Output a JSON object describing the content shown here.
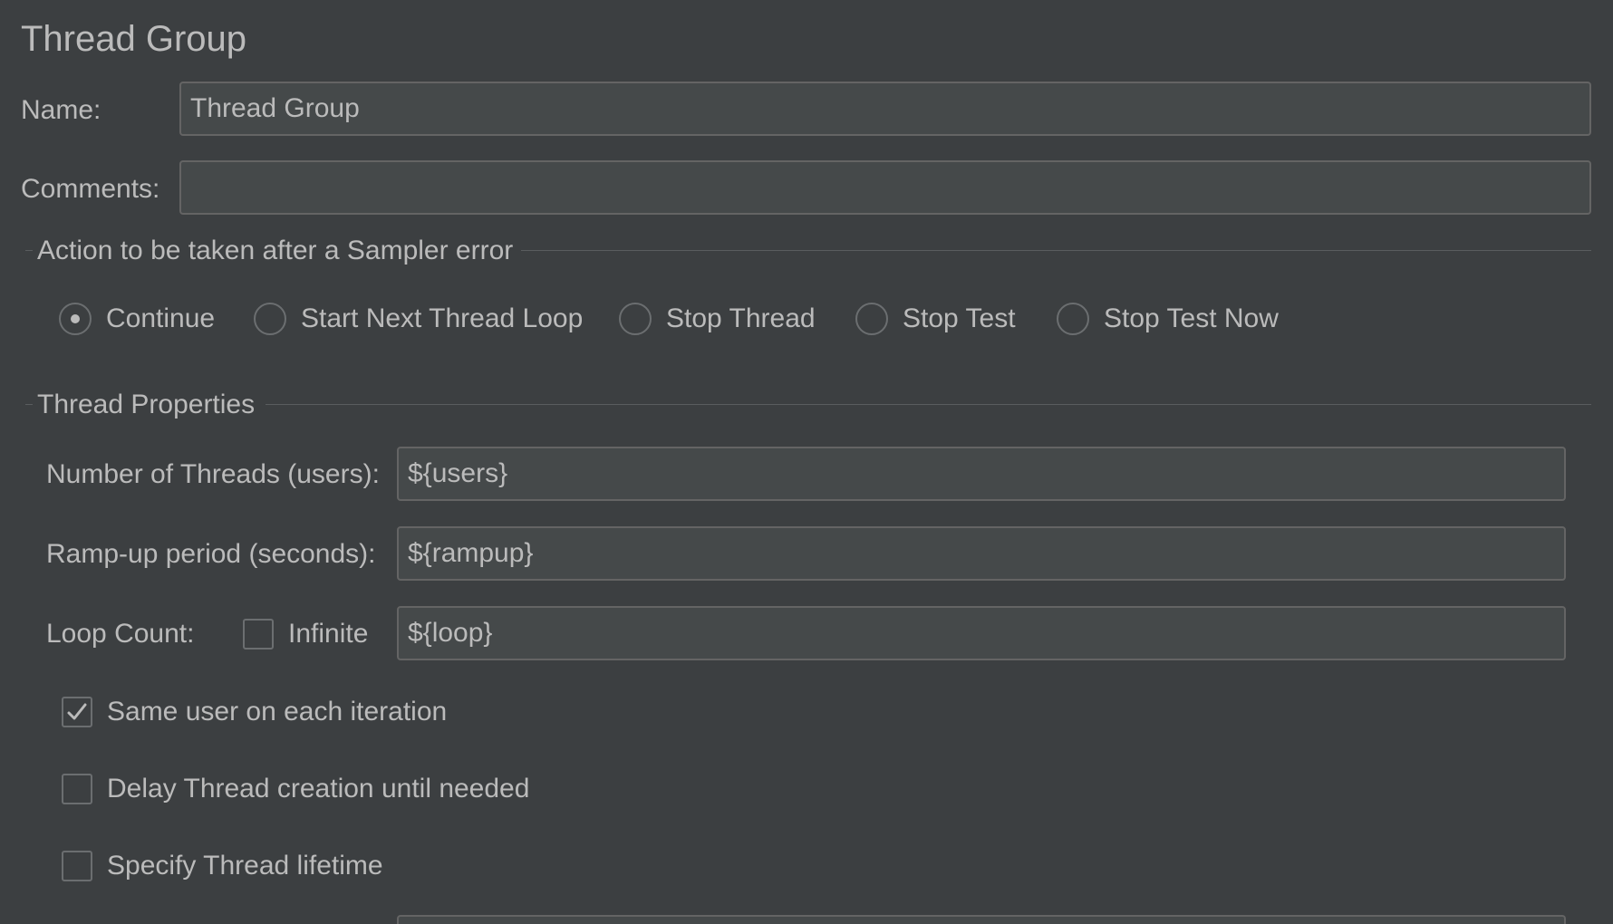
{
  "panel": {
    "title": "Thread Group"
  },
  "name_field": {
    "label": "Name:",
    "value": "Thread Group"
  },
  "comments_field": {
    "label": "Comments:",
    "value": ""
  },
  "sampler_error": {
    "title": "Action to be taken after a Sampler error",
    "options": [
      {
        "label": "Continue",
        "selected": true
      },
      {
        "label": "Start Next Thread Loop",
        "selected": false
      },
      {
        "label": "Stop Thread",
        "selected": false
      },
      {
        "label": "Stop Test",
        "selected": false
      },
      {
        "label": "Stop Test Now",
        "selected": false
      }
    ]
  },
  "thread_properties": {
    "title": "Thread Properties",
    "num_threads": {
      "label": "Number of Threads (users):",
      "value": "${users}"
    },
    "rampup": {
      "label": "Ramp-up period (seconds):",
      "value": "${rampup}"
    },
    "loop_count": {
      "label": "Loop Count:",
      "infinite_label": "Infinite",
      "infinite_checked": false,
      "value": "${loop}"
    },
    "same_user": {
      "label": "Same user on each iteration",
      "checked": true
    },
    "delay_creation": {
      "label": "Delay Thread creation until needed",
      "checked": false
    },
    "specify_lifetime": {
      "label": "Specify Thread lifetime",
      "checked": false
    }
  },
  "colors": {
    "background": "#3c3f41",
    "field_background": "#45494a",
    "field_border": "#646464",
    "text": "#bbbbbb"
  },
  "icons": {
    "checked": "check-mark-icon",
    "radio_selected": "radio-dot-icon"
  }
}
